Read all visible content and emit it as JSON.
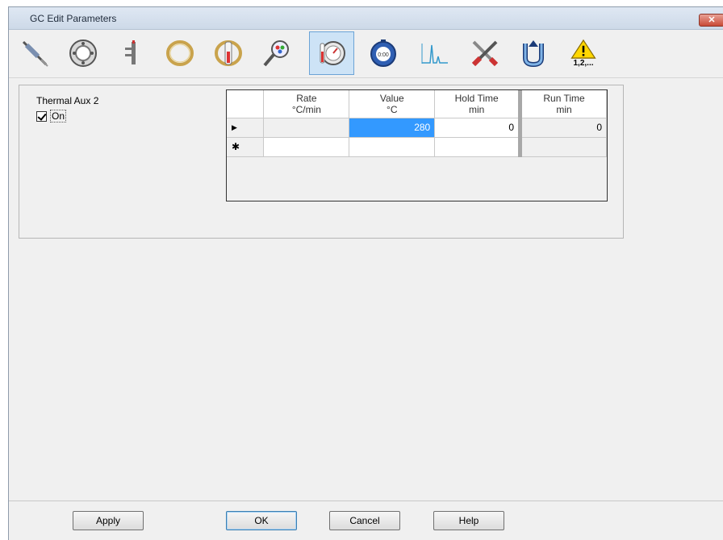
{
  "window": {
    "title": "GC Edit Parameters",
    "close_label": "✕"
  },
  "toolbar": {
    "icons": [
      "syringe-icon",
      "valve-icon",
      "inlet-icon",
      "column-icon",
      "oven-icon",
      "detector-icon",
      "thermal-aux-icon",
      "timer-icon",
      "signal-icon",
      "tools-icon",
      "configuration-icon",
      "warning-icon"
    ],
    "warning_caption": "1,2,..."
  },
  "thermal_aux": {
    "label": "Thermal Aux 2",
    "on_label": "On",
    "on_checked": true
  },
  "grid": {
    "columns": [
      {
        "line1": "Rate",
        "line2": "°C/min"
      },
      {
        "line1": "Value",
        "line2": "°C"
      },
      {
        "line1": "Hold Time",
        "line2": "min"
      },
      {
        "line1": "Run Time",
        "line2": "min"
      }
    ],
    "rows": [
      {
        "marker": "▶",
        "rate": "",
        "value": "280",
        "hold": "0",
        "run": "0"
      },
      {
        "marker": "✱",
        "rate": "",
        "value": "",
        "hold": "",
        "run": ""
      }
    ]
  },
  "buttons": {
    "apply": "Apply",
    "ok": "OK",
    "cancel": "Cancel",
    "help": "Help"
  }
}
